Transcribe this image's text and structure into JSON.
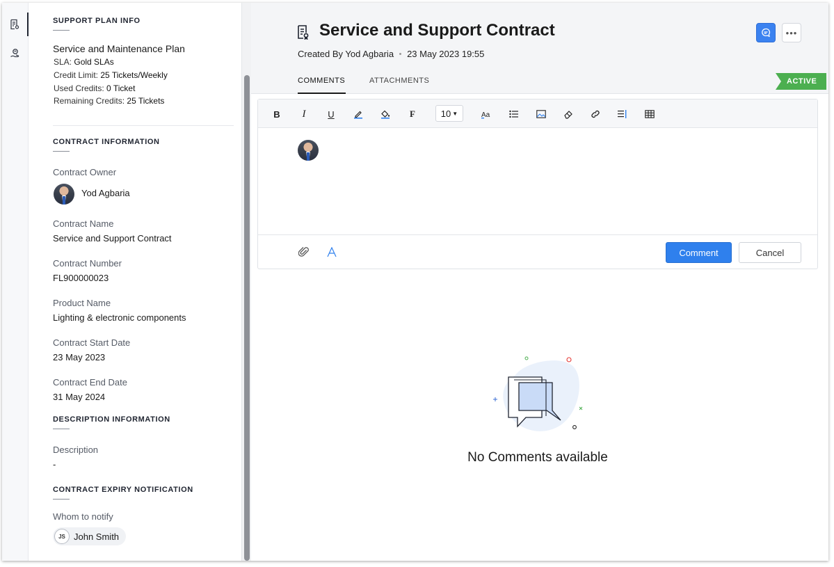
{
  "sidebar": {
    "support_plan": {
      "heading": "SUPPORT PLAN INFO",
      "plan_name": "Service and Maintenance Plan",
      "sla_label": "SLA:",
      "sla_value": "Gold SLAs",
      "credit_limit_label": "Credit Limit:",
      "credit_limit_value": "25 Tickets/Weekly",
      "used_credits_label": "Used Credits:",
      "used_credits_value": "0 Ticket",
      "remaining_credits_label": "Remaining Credits:",
      "remaining_credits_value": "25 Tickets"
    },
    "contract_info": {
      "heading": "CONTRACT INFORMATION",
      "owner_label": "Contract Owner",
      "owner_value": "Yod Agbaria",
      "name_label": "Contract Name",
      "name_value": "Service and Support Contract",
      "number_label": "Contract Number",
      "number_value": "FL900000023",
      "product_label": "Product Name",
      "product_value": "Lighting & electronic components",
      "start_label": "Contract Start Date",
      "start_value": "23 May 2023",
      "end_label": "Contract End Date",
      "end_value": "31 May 2024"
    },
    "description_info": {
      "heading": "DESCRIPTION INFORMATION",
      "description_label": "Description",
      "description_value": "-"
    },
    "expiry_notification": {
      "heading": "CONTRACT EXPIRY NOTIFICATION",
      "notify_label": "Whom to notify",
      "notify_initials": "JS",
      "notify_name": "John Smith"
    }
  },
  "header": {
    "title": "Service and Support Contract",
    "created_by": "Created By Yod Agbaria",
    "created_at": "23 May 2023 19:55",
    "status": "ACTIVE",
    "more_label": "•••",
    "tabs": [
      {
        "label": "COMMENTS",
        "active": true
      },
      {
        "label": "ATTACHMENTS",
        "active": false
      }
    ]
  },
  "editor": {
    "toolbar": {
      "bold": "B",
      "italic": "I",
      "underline": "U",
      "font_style": "F",
      "font_size": "10"
    },
    "comment_button": "Comment",
    "cancel_button": "Cancel"
  },
  "empty_state": {
    "text": "No Comments available"
  },
  "colors": {
    "accent": "#2f80ed",
    "status_active": "#4caf50"
  }
}
